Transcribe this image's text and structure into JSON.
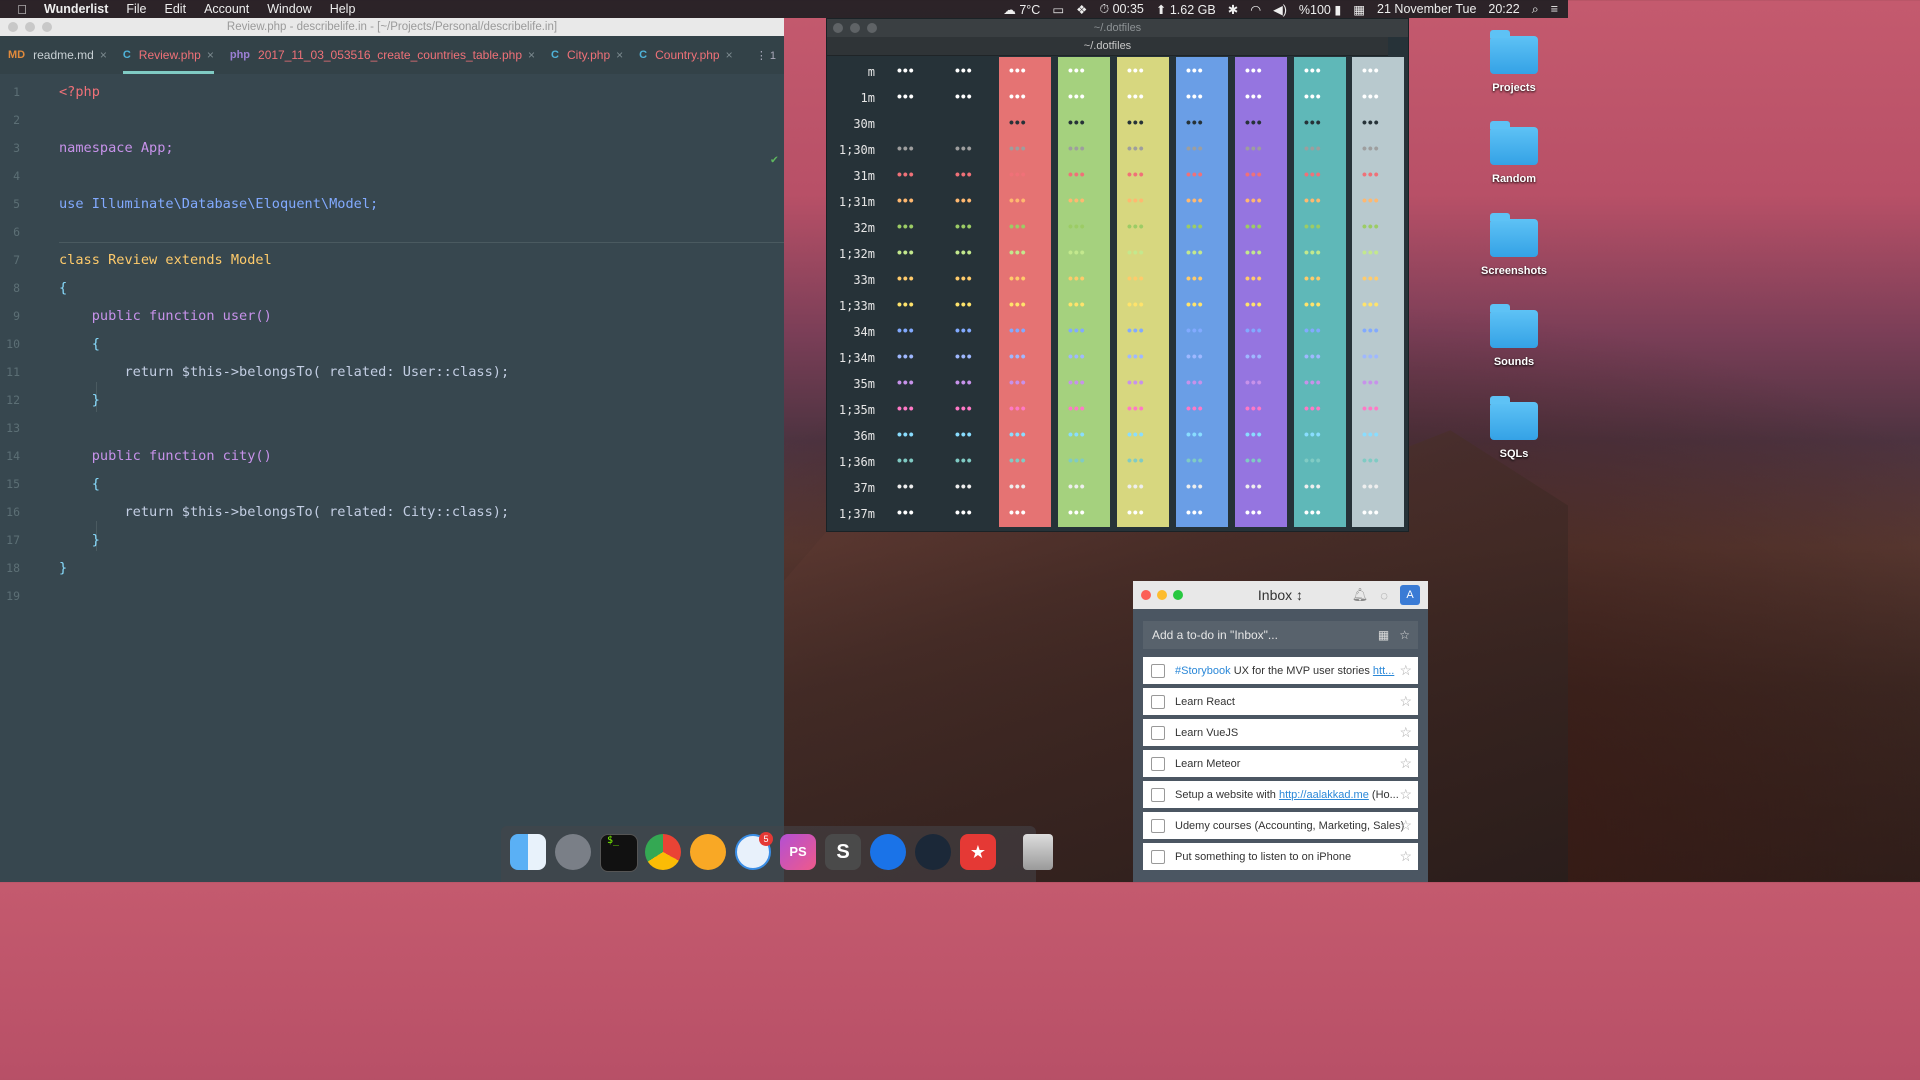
{
  "menubar": {
    "app": "Wunderlist",
    "menus": [
      "File",
      "Edit",
      "Account",
      "Window",
      "Help"
    ],
    "weather": "7°C",
    "memory": "1.62 GB",
    "timer": "00:35",
    "battery": "%100",
    "date": "21 November Tue",
    "time": "20:22"
  },
  "ide": {
    "title": "Review.php - describelife.in - [~/Projects/Personal/describelife.in]",
    "tabs": [
      {
        "label": "readme.md",
        "icon": "MD",
        "active": false
      },
      {
        "label": "Review.php",
        "icon": "C",
        "active": true
      },
      {
        "label": "2017_11_03_053516_create_countries_table.php",
        "icon": "php",
        "active": false
      },
      {
        "label": "City.php",
        "icon": "C",
        "active": false
      },
      {
        "label": "Country.php",
        "icon": "C",
        "active": false
      }
    ],
    "tabs_more": "⋮ 1",
    "code": [
      "<?php",
      "",
      "namespace App;",
      "",
      "use Illuminate\\Database\\Eloquent\\Model;",
      "",
      "class Review extends Model",
      "{",
      "    public function user()",
      "    {",
      "        return $this->belongsTo( related: User::class);",
      "    }",
      "",
      "    public function city()",
      "    {",
      "        return $this->belongsTo( related: City::class);",
      "    }",
      "}",
      ""
    ],
    "hint_label": "related:"
  },
  "terminal": {
    "title": "~/.dotfiles",
    "tab": "~/.dotfiles",
    "rows": [
      "m",
      "1m",
      "30m",
      "1;30m",
      "31m",
      "1;31m",
      "32m",
      "1;32m",
      "33m",
      "1;33m",
      "34m",
      "1;34m",
      "35m",
      "1;35m",
      "36m",
      "1;36m",
      "37m",
      "1;37m"
    ],
    "row_colors": [
      "#ffffff",
      "#ffffff",
      "#263238",
      "#9e9e9e",
      "#f07178",
      "#ffb870",
      "#9ccc65",
      "#c3e88d",
      "#ffcb6b",
      "#ffe36b",
      "#82aaff",
      "#9fb8ff",
      "#c792ea",
      "#ff79c6",
      "#89ddff",
      "#80cbc4",
      "#eeeeee",
      "#ffffff"
    ],
    "stripe_colors": [
      "#263238",
      "#263238",
      "#e57373",
      "#a5d17e",
      "#d7d77f",
      "#6a9ee6",
      "#9575e0",
      "#5fb8b8",
      "#b8c9ce"
    ],
    "glyph": "•••"
  },
  "desktop": {
    "folders": [
      "Projects",
      "Random",
      "Screenshots",
      "Sounds",
      "SQLs"
    ]
  },
  "wunderlist": {
    "list_title": "Inbox ↕",
    "avatar": "A",
    "add_placeholder": "Add a to-do in \"Inbox\"...",
    "items": [
      {
        "tag": "#Storybook",
        "text": " UX for the MVP user stories ",
        "link": "htt..."
      },
      {
        "tag": "",
        "text": "Learn React",
        "link": ""
      },
      {
        "tag": "",
        "text": "Learn VueJS",
        "link": ""
      },
      {
        "tag": "",
        "text": "Learn Meteor",
        "link": ""
      },
      {
        "tag": "",
        "text": "Setup a website with ",
        "link": "http://aalakkad.me",
        "suffix": " (Ho..."
      },
      {
        "tag": "",
        "text": "Udemy courses (Accounting, Marketing, Sales)",
        "link": ""
      },
      {
        "tag": "",
        "text": "Put something to listen to on iPhone",
        "link": ""
      }
    ]
  },
  "dock": {
    "apps": [
      "finder",
      "launchpad",
      "terminal",
      "chrome",
      "chromium",
      "airmail",
      "phpstorm",
      "sublime",
      "1password",
      "steam",
      "bookmarks",
      "trash"
    ],
    "badge": "5"
  }
}
